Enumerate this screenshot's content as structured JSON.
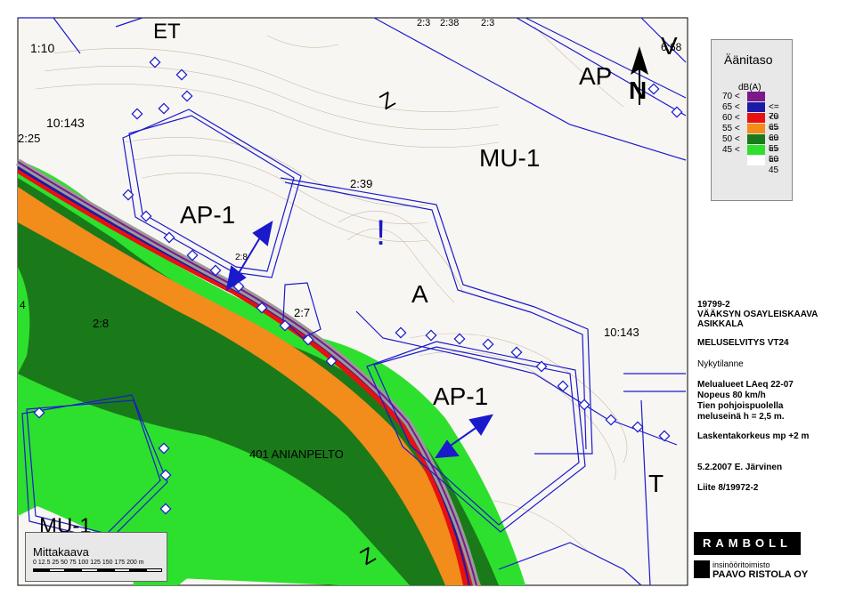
{
  "map": {
    "zone_labels": {
      "et": "ET",
      "ap_top": "AP",
      "v_top": "V",
      "mu1": "MU-1",
      "ap1_left": "AP-1",
      "ap1_right": "AP-1",
      "a": "A",
      "t": "T",
      "mu1_bottom": "MU-1"
    },
    "parcel_labels": {
      "p1_10": "1:10",
      "p10_143_left": "10:143",
      "p2_25": "2:25",
      "p2_39": "2:39",
      "p2_8_small": "2:8",
      "p2_7": "2:7",
      "p2_8": "2:8",
      "p10_143_right": "10:143",
      "p6_68": "6:68",
      "p4": "4",
      "p2_3": "2:3",
      "p2_38": "2:38",
      "p2_3b": "2:3",
      "p401": "401 ANIANPELTO"
    },
    "north_arrow_label": "N",
    "road_label_z1": "Z",
    "road_label_z2": "Z",
    "exclamation": "!"
  },
  "legend": {
    "title": "Äänitaso",
    "unit": "dB(A)",
    "rows": [
      {
        "lo": "70 <",
        "hi": "",
        "color": "#7a1a8c"
      },
      {
        "lo": "65 <",
        "hi": "<= 70",
        "color": "#1a1aa8"
      },
      {
        "lo": "60 <",
        "hi": "<= 65",
        "color": "#e81010"
      },
      {
        "lo": "55 <",
        "hi": "<= 60",
        "color": "#f28c1a"
      },
      {
        "lo": "50 <",
        "hi": "<= 55",
        "color": "#1a7a1a"
      },
      {
        "lo": "45 <",
        "hi": "<= 50",
        "color": "#2ee02e"
      },
      {
        "lo": "",
        "hi": "<= 45",
        "color": "#ffffff"
      }
    ]
  },
  "info": {
    "code": "19799-2",
    "plan": "VÄÄKSYN OSAYLEISKAAVA",
    "municipality": "ASIKKALA",
    "calc": "MELUSELVITYS VT24",
    "scenario": "Nykytilanne",
    "areas": "Melualueet LAeq 22-07",
    "speed": "Nopeus 80 km/h",
    "wall1": "Tien pohjoispuolella",
    "wall2": "meluseinä h = 2,5 m.",
    "height": "Laskentakorkeus mp +2 m",
    "date": "5.2.2007 E. Järvinen",
    "appendix": "Liite 8/19972-2"
  },
  "scale": {
    "title": "Mittakaava",
    "ticks": "0 12.5 25   50   75  100  125  150  175  200",
    "unit": "m"
  },
  "logos": {
    "ramboll": "RAMBOLL",
    "sub1": "insinööritoimisto",
    "sub2": "PAAVO RISTOLA OY"
  },
  "colors": {
    "purple": "#7a1a8c",
    "blue": "#1a1aa8",
    "red": "#e81010",
    "orange": "#f28c1a",
    "dark_green": "#1a7a1a",
    "light_green": "#2ee02e",
    "line_blue": "#1a1acc"
  }
}
